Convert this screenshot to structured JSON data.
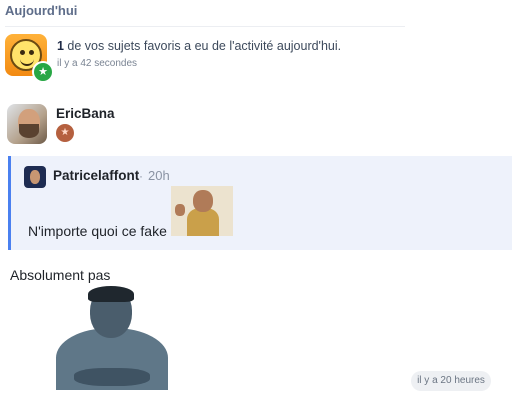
{
  "section": {
    "title": "Aujourd'hui"
  },
  "notification": {
    "count": "1",
    "text": " de vos sujets favoris a eu de l'activité aujourd'hui.",
    "time": "il y a 42 secondes",
    "icon": "smiley-icon",
    "badge_icon": "star-icon",
    "badge_color": "#28a745"
  },
  "post": {
    "author": "EricBana",
    "rank_icon": "star-rank-icon",
    "quote": {
      "author": "Patricelaffont",
      "separator": "·",
      "time": "20h",
      "text": "N'importe quoi ce fake",
      "accent_color": "#4a80f0"
    },
    "text": "Absolument pas",
    "time_pill": "il y a 20 heures"
  }
}
